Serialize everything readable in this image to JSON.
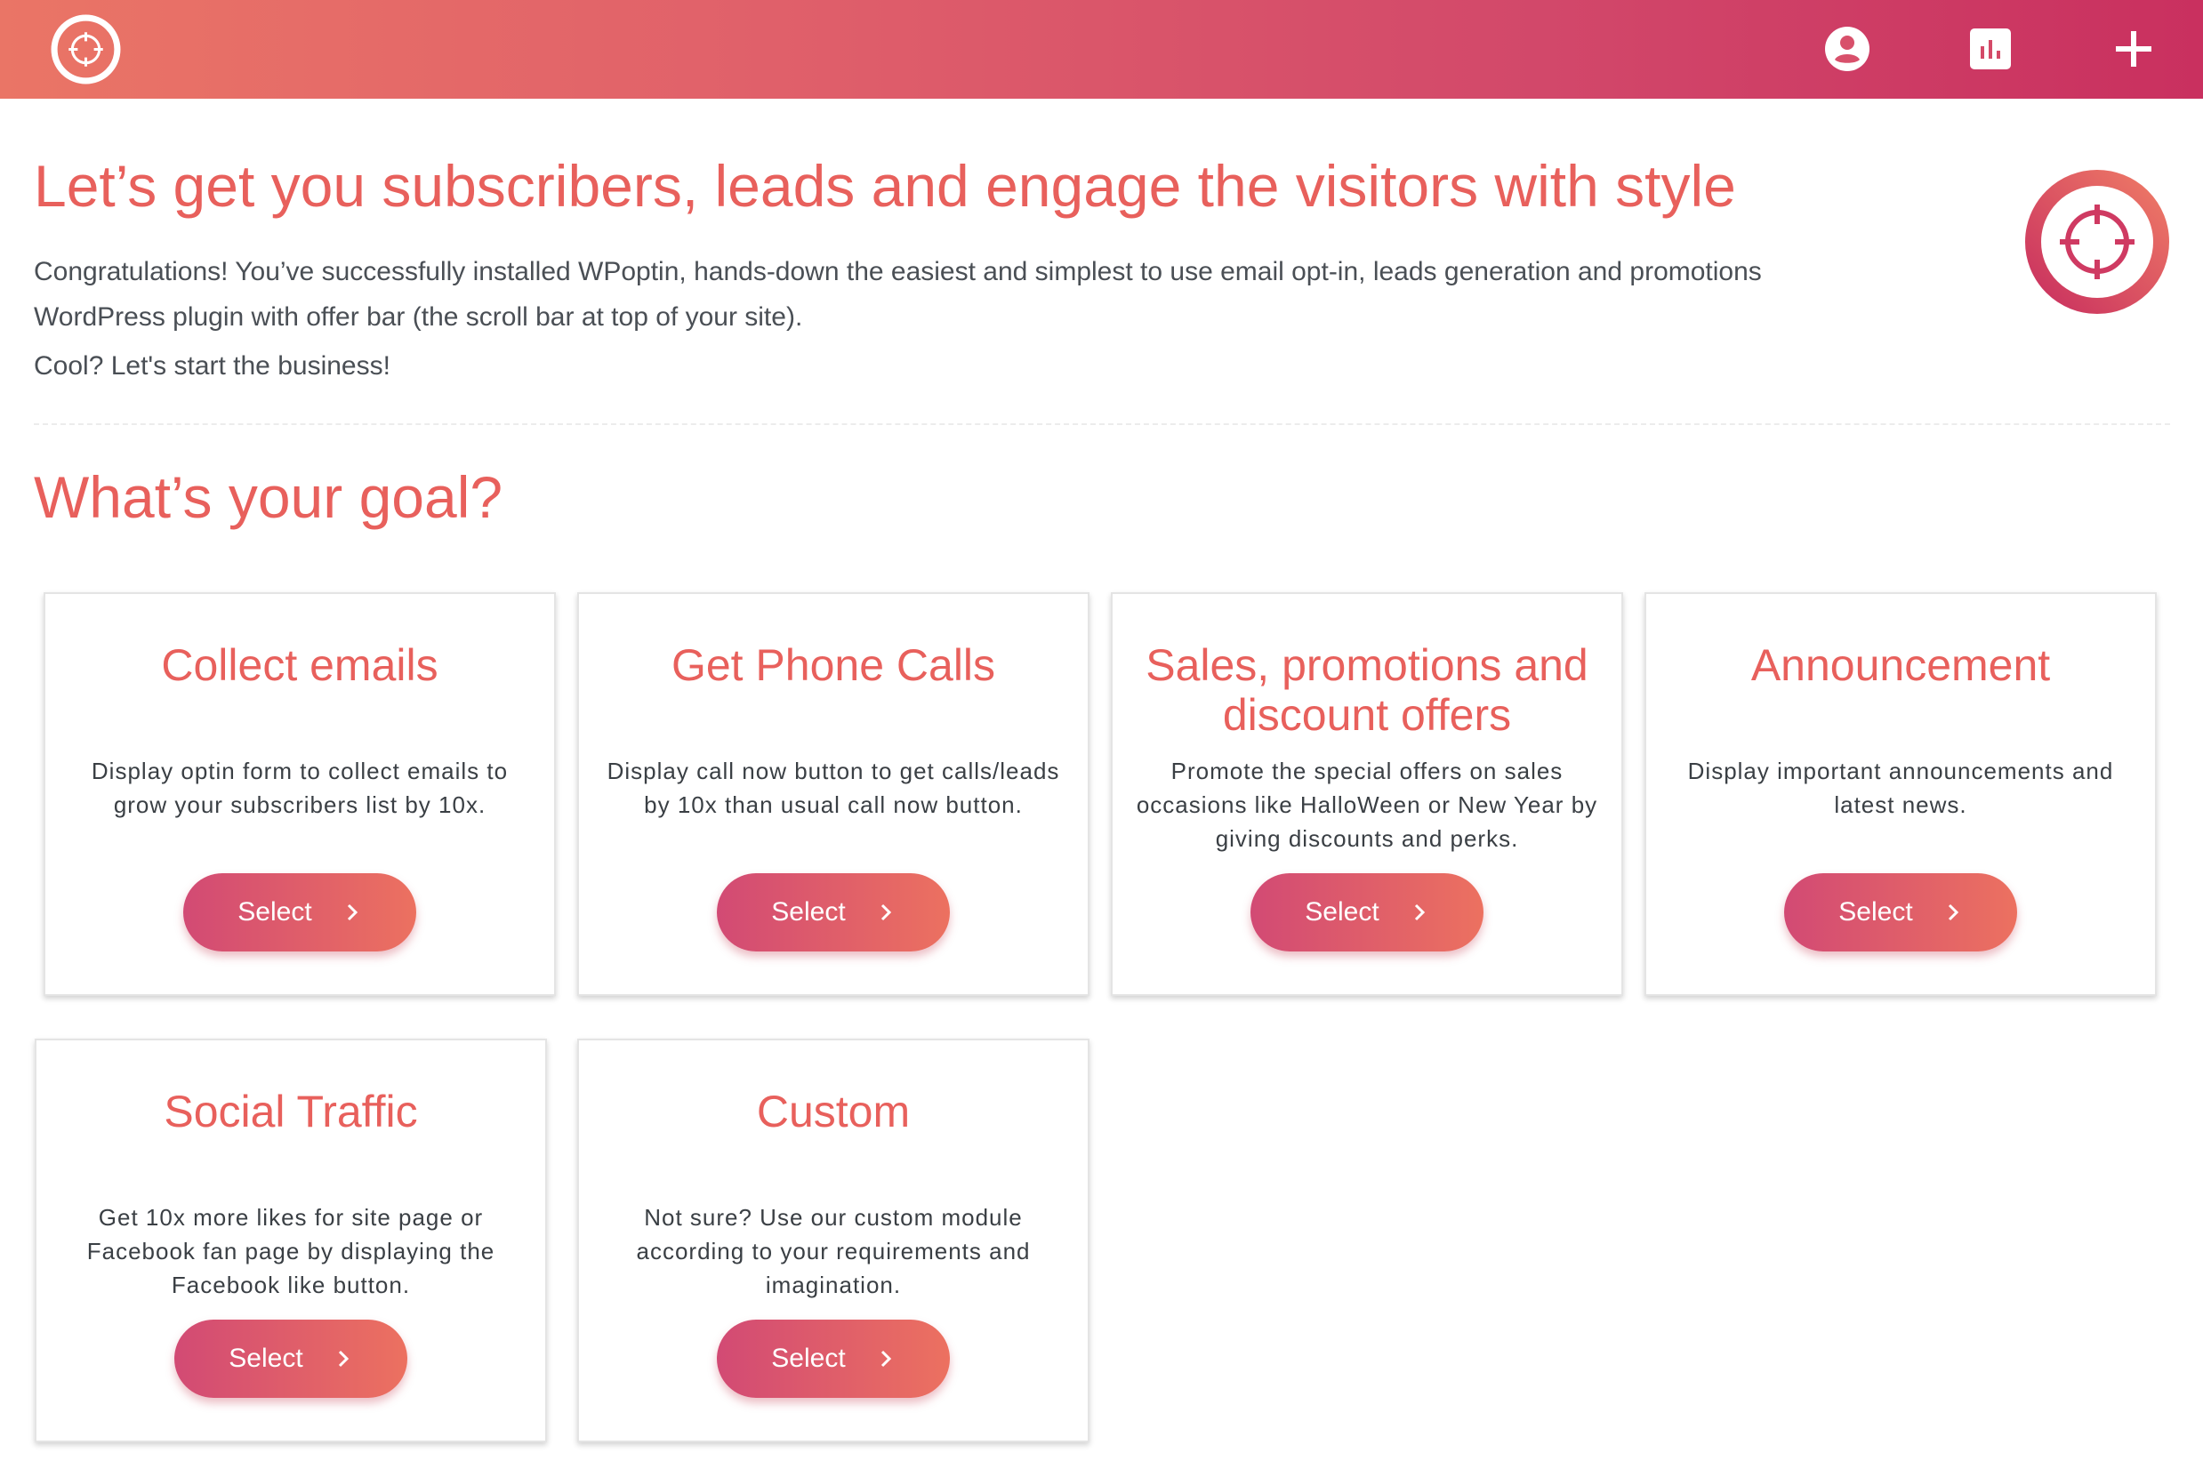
{
  "header": {
    "logo_icon": "crosshair-logo-icon",
    "actions": [
      {
        "name": "account-icon",
        "icon": "user-circle"
      },
      {
        "name": "stats-icon",
        "icon": "bar-chart"
      },
      {
        "name": "add-icon",
        "icon": "plus"
      }
    ],
    "gradient_start": "#ea7566",
    "gradient_end": "#c9305f"
  },
  "hero": {
    "title": "Let’s get you subscribers, leads and engage the visitors with style",
    "description": "Congratulations! You’ve successfully installed WPoptin, hands-down the easiest and simplest to use email opt-in, leads generation and promotions WordPress plugin with offer bar (the scroll bar at top of your site).",
    "cta": "Cool? Let's start the business!",
    "badge_icon": "crosshair-badge-icon"
  },
  "goal": {
    "title": "What’s your goal?"
  },
  "cards": [
    {
      "title": "Collect emails",
      "description": "Display optin form to collect emails to grow your subscribers list by 10x.",
      "button": "Select"
    },
    {
      "title": "Get Phone Calls",
      "description": "Display call now button to get calls/leads by 10x than usual call now button.",
      "button": "Select"
    },
    {
      "title": "Sales, promotions and discount offers",
      "description": "Promote the special offers on sales occasions like HalloWeen or New Year by giving discounts and perks.",
      "button": "Select"
    },
    {
      "title": "Announcement",
      "description": "Display important announcements and latest news.",
      "button": "Select"
    },
    {
      "title": "Social Traffic",
      "description": "Get 10x more likes for site page or Facebook fan page by displaying the Facebook like button.",
      "button": "Select"
    },
    {
      "title": "Custom",
      "description": "Not sure? Use our custom module according to your requirements and imagination.",
      "button": "Select"
    }
  ],
  "colors": {
    "accent": "#e8605c",
    "text": "#4a4f55",
    "button_start": "#d24a74",
    "button_end": "#ec7160"
  }
}
